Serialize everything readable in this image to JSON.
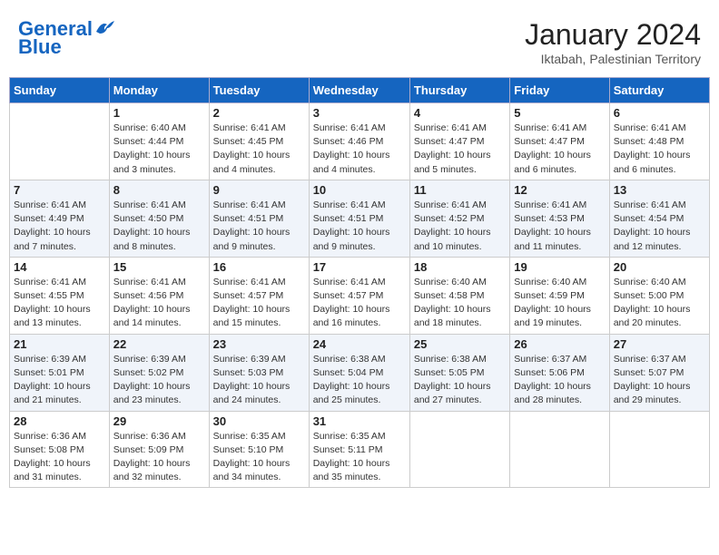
{
  "header": {
    "logo_line1": "General",
    "logo_line2": "Blue",
    "month": "January 2024",
    "location": "Iktabah, Palestinian Territory"
  },
  "weekdays": [
    "Sunday",
    "Monday",
    "Tuesday",
    "Wednesday",
    "Thursday",
    "Friday",
    "Saturday"
  ],
  "weeks": [
    [
      {
        "day": "",
        "sunrise": "",
        "sunset": "",
        "daylight": ""
      },
      {
        "day": "1",
        "sunrise": "Sunrise: 6:40 AM",
        "sunset": "Sunset: 4:44 PM",
        "daylight": "Daylight: 10 hours and 3 minutes."
      },
      {
        "day": "2",
        "sunrise": "Sunrise: 6:41 AM",
        "sunset": "Sunset: 4:45 PM",
        "daylight": "Daylight: 10 hours and 4 minutes."
      },
      {
        "day": "3",
        "sunrise": "Sunrise: 6:41 AM",
        "sunset": "Sunset: 4:46 PM",
        "daylight": "Daylight: 10 hours and 4 minutes."
      },
      {
        "day": "4",
        "sunrise": "Sunrise: 6:41 AM",
        "sunset": "Sunset: 4:47 PM",
        "daylight": "Daylight: 10 hours and 5 minutes."
      },
      {
        "day": "5",
        "sunrise": "Sunrise: 6:41 AM",
        "sunset": "Sunset: 4:47 PM",
        "daylight": "Daylight: 10 hours and 6 minutes."
      },
      {
        "day": "6",
        "sunrise": "Sunrise: 6:41 AM",
        "sunset": "Sunset: 4:48 PM",
        "daylight": "Daylight: 10 hours and 6 minutes."
      }
    ],
    [
      {
        "day": "7",
        "sunrise": "Sunrise: 6:41 AM",
        "sunset": "Sunset: 4:49 PM",
        "daylight": "Daylight: 10 hours and 7 minutes."
      },
      {
        "day": "8",
        "sunrise": "Sunrise: 6:41 AM",
        "sunset": "Sunset: 4:50 PM",
        "daylight": "Daylight: 10 hours and 8 minutes."
      },
      {
        "day": "9",
        "sunrise": "Sunrise: 6:41 AM",
        "sunset": "Sunset: 4:51 PM",
        "daylight": "Daylight: 10 hours and 9 minutes."
      },
      {
        "day": "10",
        "sunrise": "Sunrise: 6:41 AM",
        "sunset": "Sunset: 4:51 PM",
        "daylight": "Daylight: 10 hours and 9 minutes."
      },
      {
        "day": "11",
        "sunrise": "Sunrise: 6:41 AM",
        "sunset": "Sunset: 4:52 PM",
        "daylight": "Daylight: 10 hours and 10 minutes."
      },
      {
        "day": "12",
        "sunrise": "Sunrise: 6:41 AM",
        "sunset": "Sunset: 4:53 PM",
        "daylight": "Daylight: 10 hours and 11 minutes."
      },
      {
        "day": "13",
        "sunrise": "Sunrise: 6:41 AM",
        "sunset": "Sunset: 4:54 PM",
        "daylight": "Daylight: 10 hours and 12 minutes."
      }
    ],
    [
      {
        "day": "14",
        "sunrise": "Sunrise: 6:41 AM",
        "sunset": "Sunset: 4:55 PM",
        "daylight": "Daylight: 10 hours and 13 minutes."
      },
      {
        "day": "15",
        "sunrise": "Sunrise: 6:41 AM",
        "sunset": "Sunset: 4:56 PM",
        "daylight": "Daylight: 10 hours and 14 minutes."
      },
      {
        "day": "16",
        "sunrise": "Sunrise: 6:41 AM",
        "sunset": "Sunset: 4:57 PM",
        "daylight": "Daylight: 10 hours and 15 minutes."
      },
      {
        "day": "17",
        "sunrise": "Sunrise: 6:41 AM",
        "sunset": "Sunset: 4:57 PM",
        "daylight": "Daylight: 10 hours and 16 minutes."
      },
      {
        "day": "18",
        "sunrise": "Sunrise: 6:40 AM",
        "sunset": "Sunset: 4:58 PM",
        "daylight": "Daylight: 10 hours and 18 minutes."
      },
      {
        "day": "19",
        "sunrise": "Sunrise: 6:40 AM",
        "sunset": "Sunset: 4:59 PM",
        "daylight": "Daylight: 10 hours and 19 minutes."
      },
      {
        "day": "20",
        "sunrise": "Sunrise: 6:40 AM",
        "sunset": "Sunset: 5:00 PM",
        "daylight": "Daylight: 10 hours and 20 minutes."
      }
    ],
    [
      {
        "day": "21",
        "sunrise": "Sunrise: 6:39 AM",
        "sunset": "Sunset: 5:01 PM",
        "daylight": "Daylight: 10 hours and 21 minutes."
      },
      {
        "day": "22",
        "sunrise": "Sunrise: 6:39 AM",
        "sunset": "Sunset: 5:02 PM",
        "daylight": "Daylight: 10 hours and 23 minutes."
      },
      {
        "day": "23",
        "sunrise": "Sunrise: 6:39 AM",
        "sunset": "Sunset: 5:03 PM",
        "daylight": "Daylight: 10 hours and 24 minutes."
      },
      {
        "day": "24",
        "sunrise": "Sunrise: 6:38 AM",
        "sunset": "Sunset: 5:04 PM",
        "daylight": "Daylight: 10 hours and 25 minutes."
      },
      {
        "day": "25",
        "sunrise": "Sunrise: 6:38 AM",
        "sunset": "Sunset: 5:05 PM",
        "daylight": "Daylight: 10 hours and 27 minutes."
      },
      {
        "day": "26",
        "sunrise": "Sunrise: 6:37 AM",
        "sunset": "Sunset: 5:06 PM",
        "daylight": "Daylight: 10 hours and 28 minutes."
      },
      {
        "day": "27",
        "sunrise": "Sunrise: 6:37 AM",
        "sunset": "Sunset: 5:07 PM",
        "daylight": "Daylight: 10 hours and 29 minutes."
      }
    ],
    [
      {
        "day": "28",
        "sunrise": "Sunrise: 6:36 AM",
        "sunset": "Sunset: 5:08 PM",
        "daylight": "Daylight: 10 hours and 31 minutes."
      },
      {
        "day": "29",
        "sunrise": "Sunrise: 6:36 AM",
        "sunset": "Sunset: 5:09 PM",
        "daylight": "Daylight: 10 hours and 32 minutes."
      },
      {
        "day": "30",
        "sunrise": "Sunrise: 6:35 AM",
        "sunset": "Sunset: 5:10 PM",
        "daylight": "Daylight: 10 hours and 34 minutes."
      },
      {
        "day": "31",
        "sunrise": "Sunrise: 6:35 AM",
        "sunset": "Sunset: 5:11 PM",
        "daylight": "Daylight: 10 hours and 35 minutes."
      },
      {
        "day": "",
        "sunrise": "",
        "sunset": "",
        "daylight": ""
      },
      {
        "day": "",
        "sunrise": "",
        "sunset": "",
        "daylight": ""
      },
      {
        "day": "",
        "sunrise": "",
        "sunset": "",
        "daylight": ""
      }
    ]
  ]
}
